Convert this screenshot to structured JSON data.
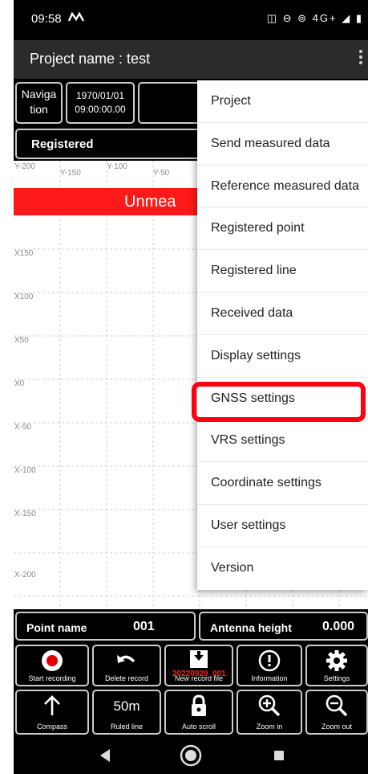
{
  "status_bar": {
    "time": "09:58",
    "carrier_icon": "M-icon",
    "right_icons": "vibrate-icon dnd-icon hotspot-icon 4G signal-icon battery-icon",
    "right_text": "◫ ⊖ ⊚ 4G+ ◢ ▮"
  },
  "app_bar": {
    "title": "Project name : test"
  },
  "info": {
    "nav_line1": "Naviga",
    "nav_line2": "tion",
    "date": "1970/01/01",
    "time": "09:00:00.00",
    "registered": "Registered"
  },
  "map": {
    "banner": "Unmea",
    "y_labels": [
      "Y-200",
      "Y-150",
      "Y-100",
      "Y-50"
    ],
    "x_labels": [
      "X150",
      "X100",
      "X50",
      "X0",
      "X-50",
      "X-100",
      "X-150",
      "X-200"
    ]
  },
  "menu": {
    "items": [
      "Project",
      "Send measured data",
      "Reference measured data",
      "Registered point",
      "Registered line",
      "Received data",
      "Display settings",
      "GNSS settings",
      "VRS settings",
      "Coordinate settings",
      "User settings",
      "Version"
    ],
    "highlighted": "GNSS settings"
  },
  "bottom": {
    "point_name_label": "Point name",
    "point_name_value": "001",
    "antenna_label": "Antenna height",
    "antenna_value": "0.000",
    "buttons_row1": [
      {
        "label": "Start recording",
        "icon": "record-icon"
      },
      {
        "label": "Delete record",
        "icon": "undo-icon"
      },
      {
        "label": "New record file",
        "icon": "new-file-icon",
        "overlay": "20220929_001"
      },
      {
        "label": "Information",
        "icon": "info-icon"
      },
      {
        "label": "Settings",
        "icon": "gear-icon"
      }
    ],
    "buttons_row2": [
      {
        "label": "Compass",
        "icon": "arrow-up-icon"
      },
      {
        "label": "Ruled line",
        "icon": "ruler-text",
        "text": "50m"
      },
      {
        "label": "Auto scroll",
        "icon": "lock-icon"
      },
      {
        "label": "Zoom in",
        "icon": "zoom-in-icon"
      },
      {
        "label": "Zoom out",
        "icon": "zoom-out-icon"
      }
    ]
  },
  "colors": {
    "accent_red": "#ff1a1a",
    "highlight_red": "#ff0010",
    "app_bar": "#2b2b2b"
  }
}
